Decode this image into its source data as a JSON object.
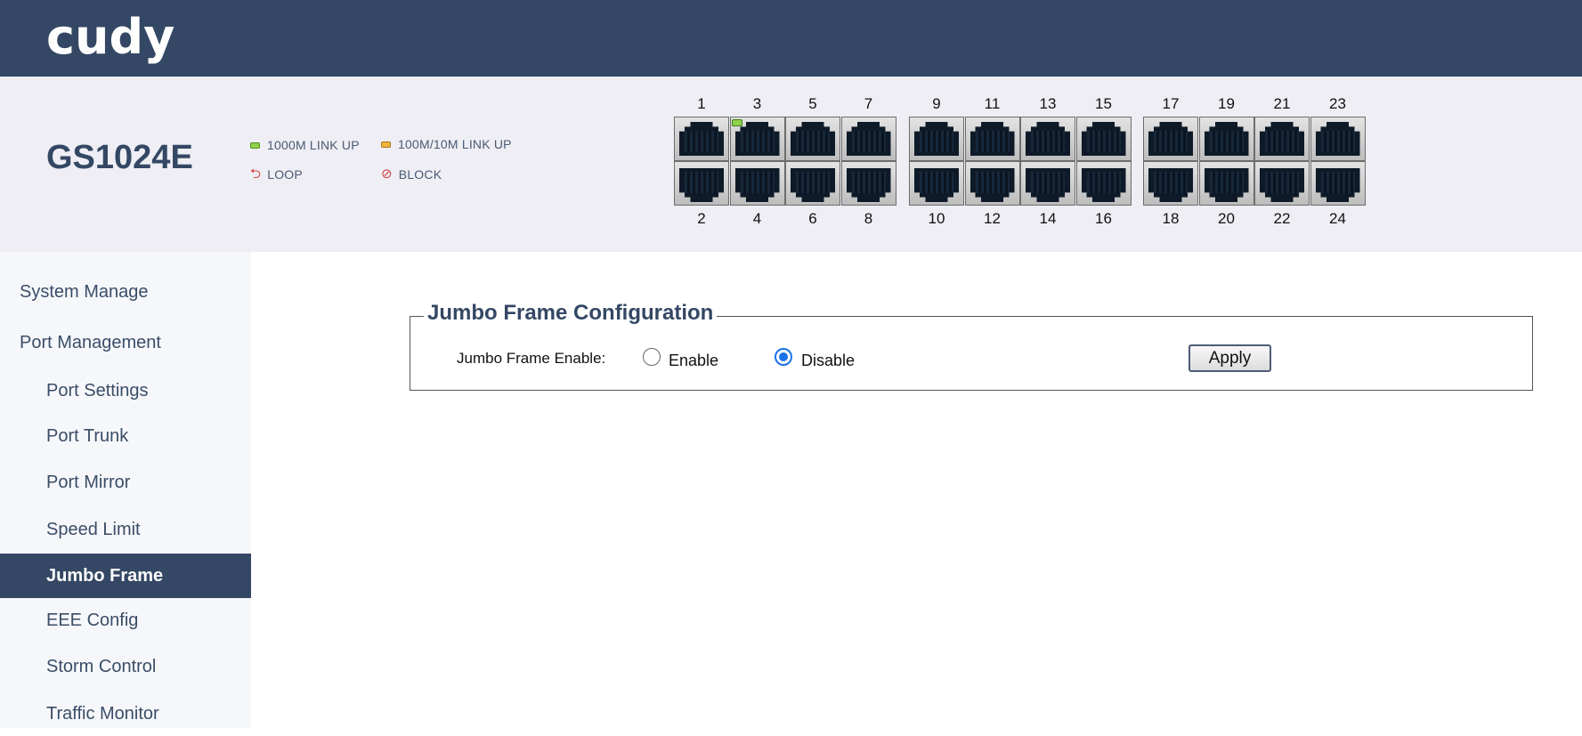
{
  "header": {
    "logo_text": "cudy"
  },
  "device": {
    "model": "GS1024E",
    "legend": {
      "link1000": "1000M LINK UP",
      "link100": "100M/10M LINK UP",
      "loop": "LOOP",
      "block": "BLOCK"
    },
    "led_colors": {
      "link1000": "#8fd14a",
      "link100": "#f0b43a",
      "alert": "#d24040"
    },
    "ports_top": [
      "1",
      "3",
      "5",
      "7",
      "9",
      "11",
      "13",
      "15",
      "17",
      "19",
      "21",
      "23"
    ],
    "ports_bottom": [
      "2",
      "4",
      "6",
      "8",
      "10",
      "12",
      "14",
      "16",
      "18",
      "20",
      "22",
      "24"
    ],
    "port_link_status": {
      "3": "1000M"
    }
  },
  "sidebar": {
    "items": [
      {
        "label": "System Manage",
        "level": "top",
        "active": false
      },
      {
        "label": "Port Management",
        "level": "top",
        "active": false
      },
      {
        "label": "Port Settings",
        "level": "sub",
        "active": false
      },
      {
        "label": "Port Trunk",
        "level": "sub",
        "active": false
      },
      {
        "label": "Port Mirror",
        "level": "sub",
        "active": false
      },
      {
        "label": "Speed Limit",
        "level": "sub",
        "active": false
      },
      {
        "label": "Jumbo Frame",
        "level": "sub",
        "active": true
      },
      {
        "label": "EEE Config",
        "level": "sub",
        "active": false
      },
      {
        "label": "Storm Control",
        "level": "sub",
        "active": false
      },
      {
        "label": "Traffic Monitor",
        "level": "sub",
        "active": false
      }
    ]
  },
  "main": {
    "section_title": "Jumbo Frame Configuration",
    "field_label": "Jumbo Frame Enable:",
    "options": [
      {
        "label": "Enable",
        "checked": false
      },
      {
        "label": "Disable",
        "checked": true
      }
    ],
    "apply_label": "Apply"
  },
  "colors": {
    "brand_navy": "#344764",
    "radio_accent": "#1a73e8"
  }
}
